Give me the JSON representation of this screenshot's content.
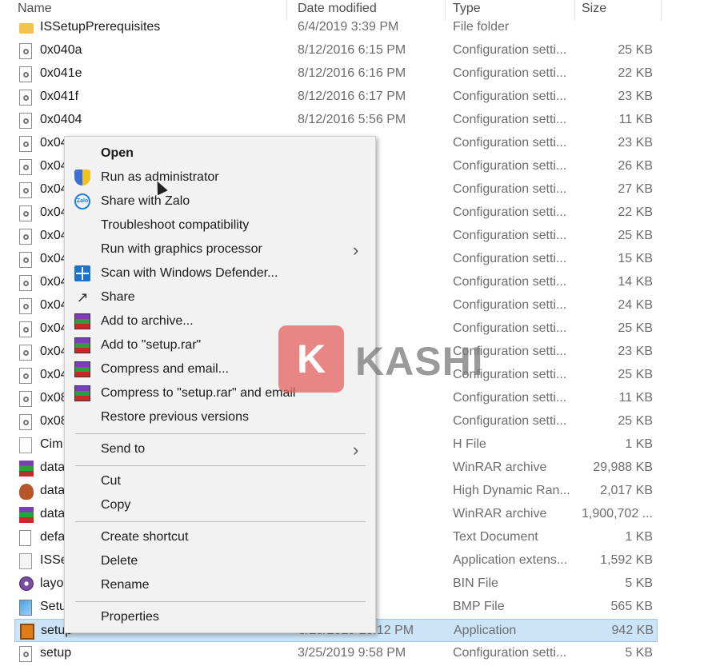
{
  "header": {
    "name": "Name",
    "date": "Date modified",
    "type": "Type",
    "size": "Size"
  },
  "rows": [
    {
      "name": "ISSetupPrerequisites",
      "date": "6/4/2019 3:39 PM",
      "type": "File folder",
      "size": "",
      "icon": "folder-icon"
    },
    {
      "name": "0x040a",
      "date": "8/12/2016 6:15 PM",
      "type": "Configuration setti...",
      "size": "25 KB",
      "icon": "config-file-icon"
    },
    {
      "name": "0x041e",
      "date": "8/12/2016 6:16 PM",
      "type": "Configuration setti...",
      "size": "22 KB",
      "icon": "config-file-icon"
    },
    {
      "name": "0x041f",
      "date": "8/12/2016 6:17 PM",
      "type": "Configuration setti...",
      "size": "23 KB",
      "icon": "config-file-icon"
    },
    {
      "name": "0x0404",
      "date": "8/12/2016 5:56 PM",
      "type": "Configuration setti...",
      "size": "11 KB",
      "icon": "config-file-icon"
    },
    {
      "name": "0x04",
      "date": "7 PM",
      "type": "Configuration setti...",
      "size": "23 KB",
      "icon": "config-file-icon"
    },
    {
      "name": "0x04",
      "date": "3 PM",
      "type": "Configuration setti...",
      "size": "26 KB",
      "icon": "config-file-icon"
    },
    {
      "name": "0x04",
      "date": "3 PM",
      "type": "Configuration setti...",
      "size": "27 KB",
      "icon": "config-file-icon"
    },
    {
      "name": "0x04",
      "date": "4 PM",
      "type": "Configuration setti...",
      "size": "22 KB",
      "icon": "config-file-icon"
    },
    {
      "name": "0x04",
      "date": "7 PM",
      "type": "Configuration setti...",
      "size": "25 KB",
      "icon": "config-file-icon"
    },
    {
      "name": "0x04",
      "date": "57 PM",
      "type": "Configuration setti...",
      "size": "15 KB",
      "icon": "config-file-icon"
    },
    {
      "name": "0x04",
      "date": "8 PM",
      "type": "Configuration setti...",
      "size": "14 KB",
      "icon": "config-file-icon"
    },
    {
      "name": "0x04",
      "date": "1 PM",
      "type": "Configuration setti...",
      "size": "24 KB",
      "icon": "config-file-icon"
    },
    {
      "name": "0x04",
      "date": "1 PM",
      "type": "Configuration setti...",
      "size": "25 KB",
      "icon": "config-file-icon"
    },
    {
      "name": "0x04",
      "date": "1 PM",
      "type": "Configuration setti...",
      "size": "23 KB",
      "icon": "config-file-icon"
    },
    {
      "name": "0x04",
      "date": "5 PM",
      "type": "Configuration setti...",
      "size": "25 KB",
      "icon": "config-file-icon"
    },
    {
      "name": "0x08",
      "date": "4 PM",
      "type": "Configuration setti...",
      "size": "11 KB",
      "icon": "config-file-icon"
    },
    {
      "name": "0x08",
      "date": "0 PM",
      "type": "Configuration setti...",
      "size": "25 KB",
      "icon": "config-file-icon"
    },
    {
      "name": "Cim",
      "date": "1 PM",
      "type": "H File",
      "size": "1 KB",
      "icon": "h-file-icon"
    },
    {
      "name": "data",
      "date": "9 PM",
      "type": "WinRAR archive",
      "size": "29,988 KB",
      "icon": "winrar-icon"
    },
    {
      "name": "data",
      "date": "9 PM",
      "type": "High Dynamic Ran...",
      "size": "2,017 KB",
      "icon": "hdr-file-icon"
    },
    {
      "name": "data",
      "date": "02 PM",
      "type": "WinRAR archive",
      "size": "1,900,702 ...",
      "icon": "winrar-icon"
    },
    {
      "name": "defa",
      "date": "0 PM",
      "type": "Text Document",
      "size": "1 KB",
      "icon": "text-file-icon"
    },
    {
      "name": "ISSe",
      "date": "12 PM",
      "type": "Application extens...",
      "size": "1,592 KB",
      "icon": "dll-file-icon"
    },
    {
      "name": "layo",
      "date": "02 PM",
      "type": "BIN File",
      "size": "5 KB",
      "icon": "bin-file-icon"
    },
    {
      "name": "Setu",
      "date": "0 PM",
      "type": "BMP File",
      "size": "565 KB",
      "icon": "bmp-file-icon"
    },
    {
      "name": "setup",
      "date": "3/25/2019 10:12 PM",
      "type": "Application",
      "size": "942 KB",
      "icon": "application-icon",
      "selected": true
    },
    {
      "name": "setup",
      "date": "3/25/2019 9:58 PM",
      "type": "Configuration setti...",
      "size": "5 KB",
      "icon": "config-file-icon"
    }
  ],
  "context_menu": {
    "items": [
      {
        "label": "Open",
        "bold": true,
        "icon": ""
      },
      {
        "label": "Run as administrator",
        "icon": "uac-shield-icon"
      },
      {
        "label": "Share with Zalo",
        "icon": "zalo-icon"
      },
      {
        "label": "Troubleshoot compatibility",
        "icon": ""
      },
      {
        "label": "Run with graphics processor",
        "icon": "",
        "submenu": true
      },
      {
        "label": "Scan with Windows Defender...",
        "icon": "windows-defender-icon"
      },
      {
        "label": "Share",
        "icon": "share-icon"
      },
      {
        "label": "Add to archive...",
        "icon": "winrar-icon"
      },
      {
        "label": "Add to \"setup.rar\"",
        "icon": "winrar-icon"
      },
      {
        "label": "Compress and email...",
        "icon": "winrar-icon"
      },
      {
        "label": "Compress to \"setup.rar\" and email",
        "icon": "winrar-icon"
      },
      {
        "label": "Restore previous versions",
        "icon": ""
      },
      {
        "label": "Send to",
        "icon": "",
        "submenu": true
      },
      {
        "label": "Cut",
        "icon": ""
      },
      {
        "label": "Copy",
        "icon": ""
      },
      {
        "label": "Create shortcut",
        "icon": ""
      },
      {
        "label": "Delete",
        "icon": ""
      },
      {
        "label": "Rename",
        "icon": ""
      },
      {
        "label": "Properties",
        "icon": ""
      }
    ]
  },
  "watermark": {
    "badge": "K",
    "text": "KASHI"
  },
  "colors": {
    "selection": "#cce4f7",
    "menu_bg": "#f2f2f2"
  }
}
